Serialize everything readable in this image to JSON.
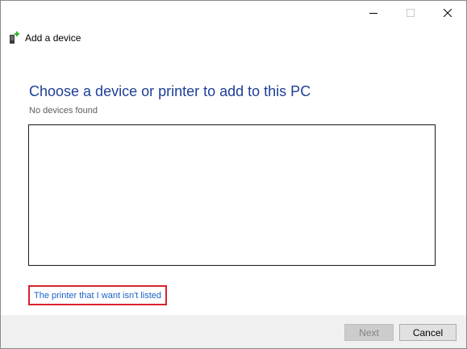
{
  "window": {
    "title": "Add a device",
    "controls": {
      "minimize_icon": "minimize-icon",
      "maximize_icon": "maximize-icon",
      "close_icon": "close-icon"
    }
  },
  "main": {
    "heading": "Choose a device or printer to add to this PC",
    "status": "No devices found",
    "device_list": [],
    "printer_link": "The printer that I want isn't listed"
  },
  "footer": {
    "next_label": "Next",
    "next_enabled": false,
    "cancel_label": "Cancel"
  },
  "colors": {
    "heading": "#1e3f96",
    "link": "#1964c8",
    "highlight_border": "#d9232e",
    "footer_bg": "#f0f0f0",
    "icon_green": "#2db52d"
  }
}
